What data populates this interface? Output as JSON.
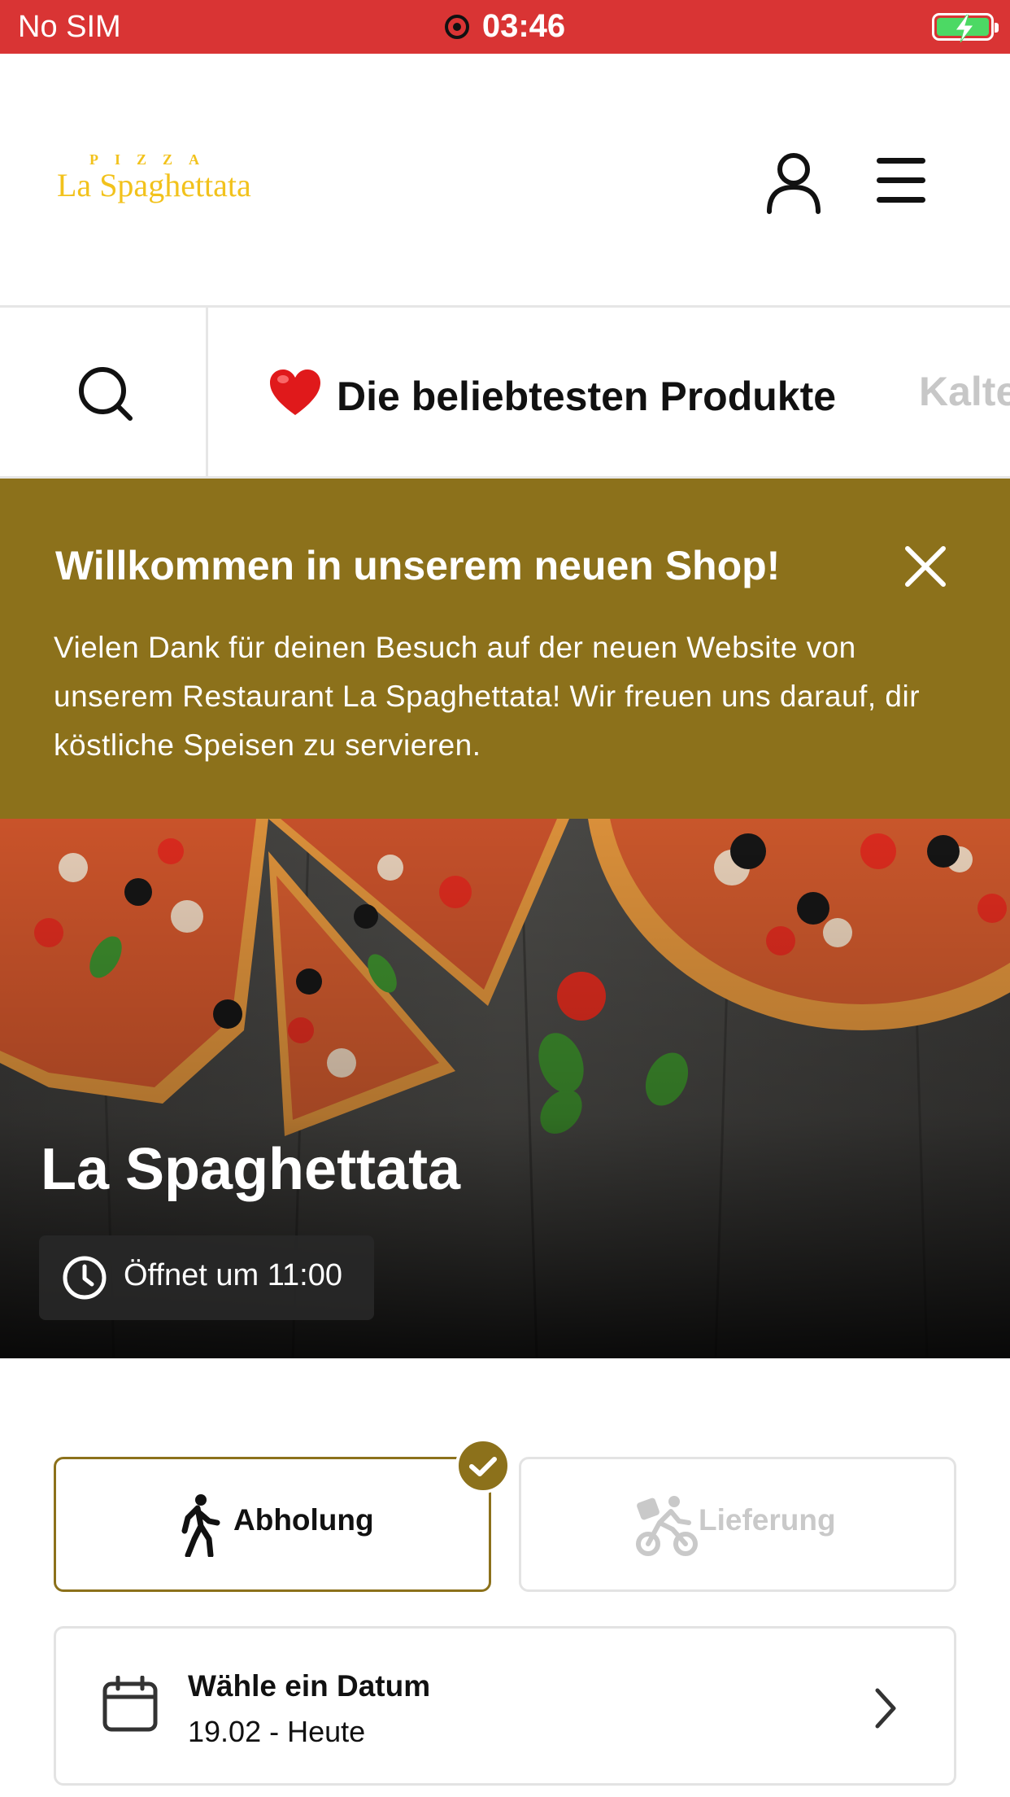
{
  "status_bar": {
    "carrier": "No SIM",
    "time": "03:46",
    "battery_state": "charging"
  },
  "header": {
    "logo_small": "PIZZA",
    "logo_name": "La Spaghettata",
    "account_icon": "user-icon",
    "menu_icon": "hamburger-menu-icon"
  },
  "categories": {
    "search_icon": "search-icon",
    "active": {
      "emoji": "heart",
      "label": "Die beliebtesten Produkte"
    },
    "next": {
      "label": "Kalte"
    }
  },
  "banner": {
    "title": "Willkommen in unserem neuen Shop!",
    "text": "Vielen Dank für deinen Besuch auf der neuen Website von unserem Restaurant La Spaghettata! Wir freuen uns darauf, dir köstliche Speisen zu servieren.",
    "close_icon": "close-icon",
    "color": "#8c711b"
  },
  "hero": {
    "restaurant_name": "La Spaghettata",
    "opening": "Öffnet um 11:00"
  },
  "order_mode": {
    "pickup_label": "Abholung",
    "delivery_label": "Lieferung",
    "selected": "pickup"
  },
  "date_picker": {
    "title": "Wähle ein Datum",
    "value": "19.02 - Heute"
  },
  "colors": {
    "status_bar": "#d93434",
    "accent": "#8c711b",
    "logo": "#f2c21c"
  }
}
